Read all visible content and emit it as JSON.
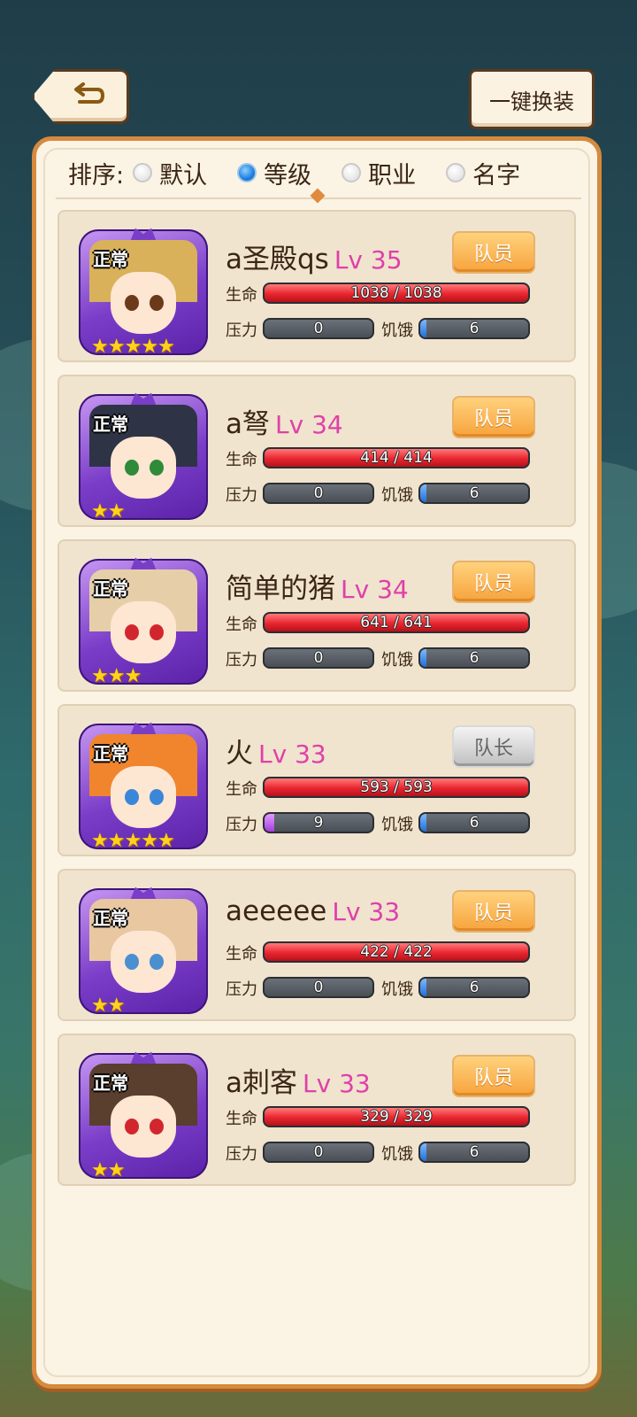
{
  "header": {
    "equip_all_label": "一键换装"
  },
  "sort": {
    "label": "排序:",
    "options": [
      {
        "label": "默认",
        "selected": false
      },
      {
        "label": "等级",
        "selected": true
      },
      {
        "label": "职业",
        "selected": false
      },
      {
        "label": "名字",
        "selected": false
      }
    ]
  },
  "stat_labels": {
    "hp": "生命",
    "stress": "压力",
    "hunger": "饥饿"
  },
  "characters": [
    {
      "name": "a圣殿qs",
      "level": "Lv 35",
      "status": "正常",
      "stars": 5,
      "role": "队员",
      "hp_text": "1038 / 1038",
      "hp_fraction": 1.0,
      "stress": "0",
      "stress_fraction": 0.0,
      "hunger": "6",
      "hunger_fraction": 0.06,
      "hair": "#d9b15a",
      "eye": "#6b3a1a"
    },
    {
      "name": "a弩",
      "level": "Lv 34",
      "status": "正常",
      "stars": 2,
      "role": "队员",
      "hp_text": "414 / 414",
      "hp_fraction": 1.0,
      "stress": "0",
      "stress_fraction": 0.0,
      "hunger": "6",
      "hunger_fraction": 0.06,
      "hair": "#2e3446",
      "eye": "#2f8a3a"
    },
    {
      "name": "简单的猪",
      "level": "Lv 34",
      "status": "正常",
      "stars": 3,
      "role": "队员",
      "hp_text": "641 / 641",
      "hp_fraction": 1.0,
      "stress": "0",
      "stress_fraction": 0.0,
      "hunger": "6",
      "hunger_fraction": 0.06,
      "hair": "#e6cfa8",
      "eye": "#d2262e"
    },
    {
      "name": "火",
      "level": "Lv 33",
      "status": "正常",
      "stars": 5,
      "role": "队长",
      "hp_text": "593 / 593",
      "hp_fraction": 1.0,
      "stress": "9",
      "stress_fraction": 0.09,
      "hunger": "6",
      "hunger_fraction": 0.06,
      "hair": "#f0852e",
      "eye": "#3a86d8"
    },
    {
      "name": "aeeeee",
      "level": "Lv 33",
      "status": "正常",
      "stars": 2,
      "role": "队员",
      "hp_text": "422 / 422",
      "hp_fraction": 1.0,
      "stress": "0",
      "stress_fraction": 0.0,
      "hunger": "6",
      "hunger_fraction": 0.06,
      "hair": "#e9c7a1",
      "eye": "#4a8fd0"
    },
    {
      "name": "a刺客",
      "level": "Lv 33",
      "status": "正常",
      "stars": 2,
      "role": "队员",
      "hp_text": "329 / 329",
      "hp_fraction": 1.0,
      "stress": "0",
      "stress_fraction": 0.0,
      "hunger": "6",
      "hunger_fraction": 0.06,
      "hair": "#5a3e2e",
      "eye": "#d2262e"
    }
  ],
  "colors": {
    "panel_border": "#d58a3e",
    "level_text": "#e040a8",
    "hp_fill": "#e8252f",
    "stress_fill": "#a43ee0",
    "hunger_fill": "#1e6fd8",
    "member_button": "#f7a33c",
    "leader_button": "#bfbfbf"
  },
  "icons": {
    "back": "return-arrow-icon",
    "radio": "radio-icon",
    "star": "star-icon"
  }
}
